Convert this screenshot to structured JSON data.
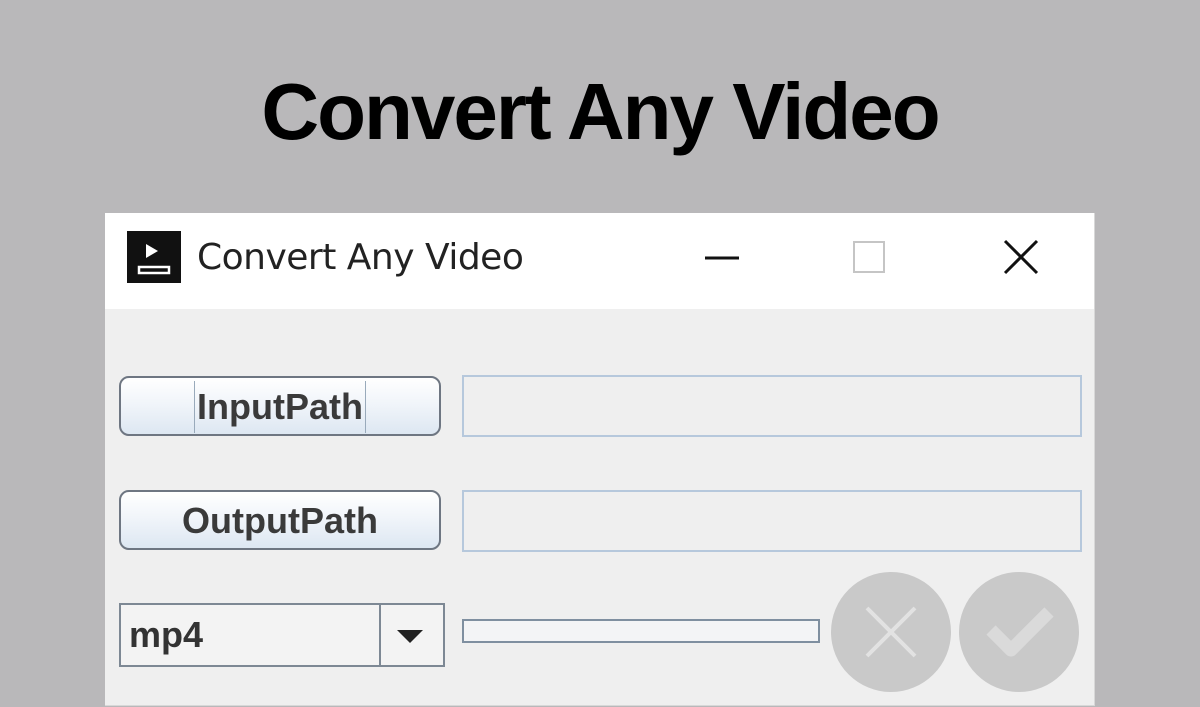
{
  "banner": {
    "title": "Convert Any Video"
  },
  "window": {
    "title": "Convert Any Video",
    "icons": {
      "app": "video-converter-icon",
      "minimize": "minimize-icon",
      "maximize": "maximize-icon",
      "close": "close-icon"
    }
  },
  "form": {
    "input_button_label": "InputPath",
    "input_path_value": "",
    "output_button_label": "OutputPath",
    "output_path_value": "",
    "format_selected": "mp4",
    "progress_fraction": 0,
    "cancel_icon": "x-circle-icon",
    "confirm_icon": "check-circle-icon",
    "action_buttons_state": "disabled"
  },
  "colors": {
    "background": "#b9b8ba",
    "window_bg": "#efefef",
    "titlebar_bg": "#ffffff",
    "field_border": "#b6c8dc",
    "disabled_button": "#c8c8c8"
  }
}
